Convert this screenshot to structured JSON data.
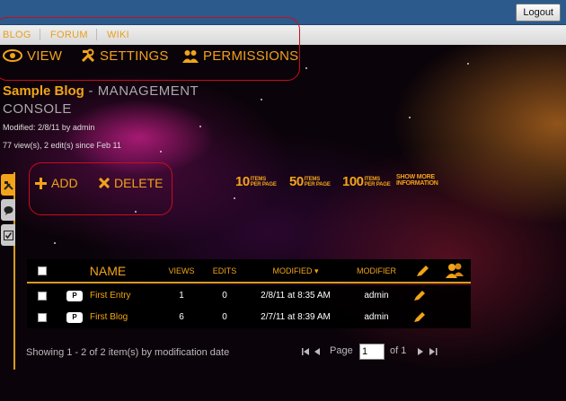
{
  "topbar": {
    "logout_label": "Logout"
  },
  "crumbs": [
    "BLOG",
    "FORUM",
    "WIKI"
  ],
  "mainnav": {
    "view": "VIEW",
    "settings": "SETTINGS",
    "permissions": "PERMISSIONS"
  },
  "page": {
    "title": "Sample Blog",
    "subtitle_part1": " - MANAGEMENT",
    "subtitle_part2": "CONSOLE",
    "modified": "Modified: 2/8/11 by admin",
    "stats": "77 view(s), 2 edit(s) since Feb 11"
  },
  "actions": {
    "add": "ADD",
    "delete": "DELETE"
  },
  "perpage": [
    {
      "num": "10",
      "top": "ITEMS",
      "bottom": "PER PAGE"
    },
    {
      "num": "50",
      "top": "ITEMS",
      "bottom": "PER PAGE"
    },
    {
      "num": "100",
      "top": "ITEMS",
      "bottom": "PER PAGE"
    }
  ],
  "show_more": {
    "top": "SHOW MORE",
    "bottom": "INFORMATION"
  },
  "grid": {
    "headers": {
      "name": "NAME",
      "views": "VIEWS",
      "edits": "EDITS",
      "modified": "MODIFIED ▾",
      "modifier": "MODIFIER"
    },
    "rows": [
      {
        "type": "P",
        "name": "First Entry",
        "views": "1",
        "edits": "0",
        "modified": "2/8/11 at 8:35 AM",
        "modifier": "admin"
      },
      {
        "type": "P",
        "name": "First Blog",
        "views": "6",
        "edits": "0",
        "modified": "2/7/11 at 8:39 AM",
        "modifier": "admin"
      }
    ]
  },
  "footer": {
    "status": "Showing 1 - 2 of 2 item(s) by modification date",
    "page_label": "Page",
    "page_value": "1",
    "of_label": "of 1"
  },
  "colors": {
    "accent": "#f2a418",
    "topbar": "#2c5a8c",
    "annotation": "#cc0b1c"
  },
  "icons": [
    "eye-icon",
    "tools-icon",
    "users-icon",
    "plus-icon",
    "x-icon",
    "pencil-icon",
    "people-icon",
    "first-page-icon",
    "prev-page-icon",
    "next-page-icon",
    "last-page-icon"
  ]
}
